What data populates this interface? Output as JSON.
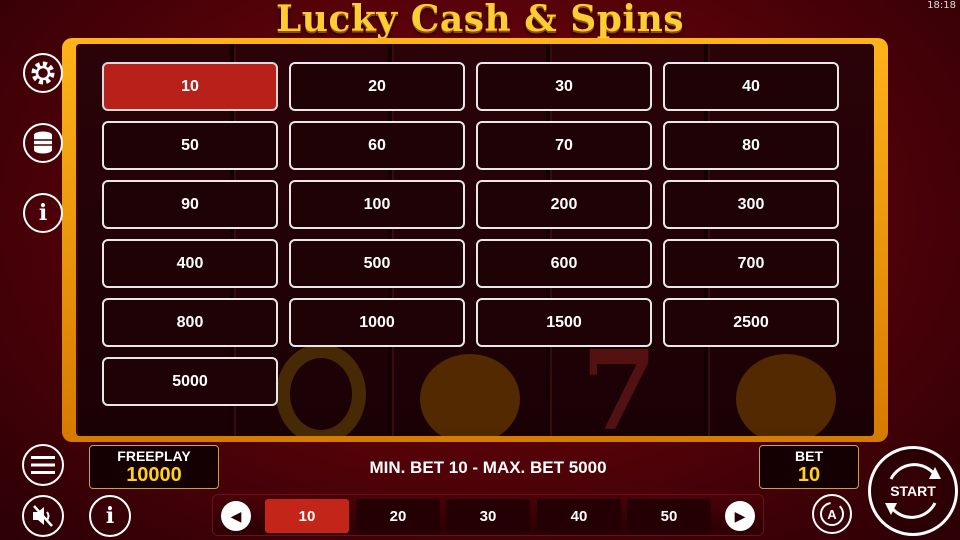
{
  "clock": "18:18",
  "title": "Lucky Cash & Spins",
  "bet_options": [
    {
      "label": "10",
      "selected": true
    },
    {
      "label": "20",
      "selected": false
    },
    {
      "label": "30",
      "selected": false
    },
    {
      "label": "40",
      "selected": false
    },
    {
      "label": "50",
      "selected": false
    },
    {
      "label": "60",
      "selected": false
    },
    {
      "label": "70",
      "selected": false
    },
    {
      "label": "80",
      "selected": false
    },
    {
      "label": "90",
      "selected": false
    },
    {
      "label": "100",
      "selected": false
    },
    {
      "label": "200",
      "selected": false
    },
    {
      "label": "300",
      "selected": false
    },
    {
      "label": "400",
      "selected": false
    },
    {
      "label": "500",
      "selected": false
    },
    {
      "label": "600",
      "selected": false
    },
    {
      "label": "700",
      "selected": false
    },
    {
      "label": "800",
      "selected": false
    },
    {
      "label": "1000",
      "selected": false
    },
    {
      "label": "1500",
      "selected": false
    },
    {
      "label": "2500",
      "selected": false
    },
    {
      "label": "5000",
      "selected": false
    }
  ],
  "side_icons": [
    "gear-icon",
    "coins-icon",
    "info-icon"
  ],
  "freeplay": {
    "label": "FREEPLAY",
    "value": "10000"
  },
  "bet": {
    "label": "BET",
    "value": "10"
  },
  "limits": "MIN. BET 10 - MAX. BET 5000",
  "quick_bets": [
    {
      "label": "10",
      "selected": true
    },
    {
      "label": "20",
      "selected": false
    },
    {
      "label": "30",
      "selected": false
    },
    {
      "label": "40",
      "selected": false
    },
    {
      "label": "50",
      "selected": false
    }
  ],
  "start_label": "START",
  "colors": {
    "accent": "#ffd21a",
    "selected": "#b8201a",
    "frame": "#ffb31a"
  }
}
